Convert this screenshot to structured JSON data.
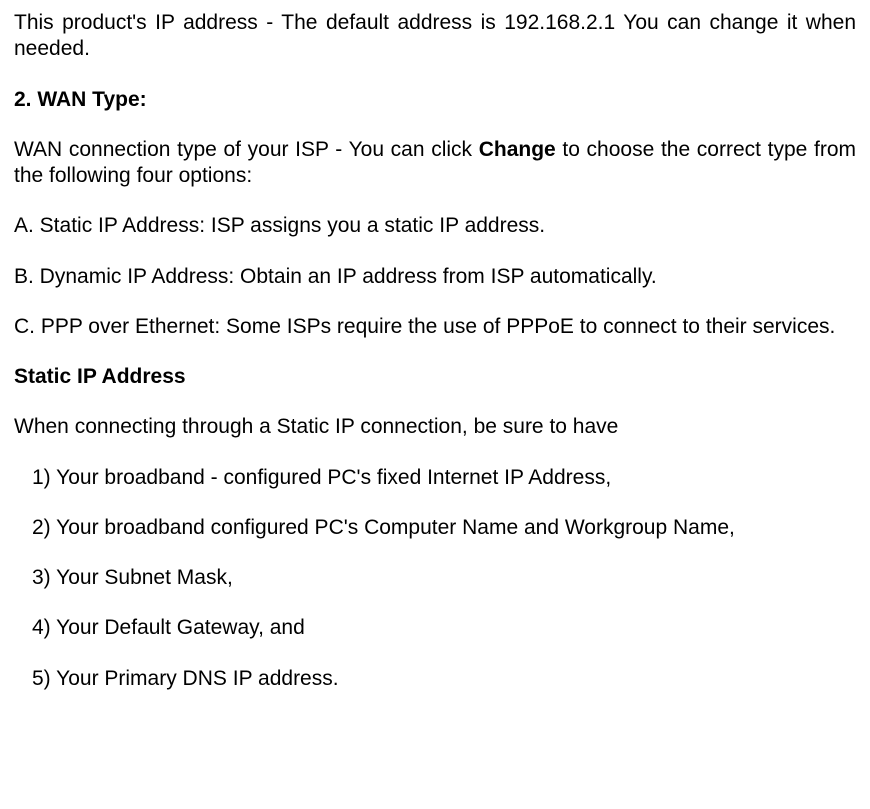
{
  "intro": {
    "p1": "This product's IP address - The default address is 192.168.2.1 You can change it when needed."
  },
  "section2": {
    "heading": "2. WAN Type:",
    "lead_pre": "WAN connection type of your ISP - You can click ",
    "lead_bold": "Change",
    "lead_post": " to choose the correct type from the following four options:",
    "optA": "A. Static IP Address: ISP assigns you a static IP address.",
    "optB": "B. Dynamic IP Address: Obtain an IP address from ISP automatically.",
    "optC": "C. PPP over Ethernet: Some ISPs require the use of PPPoE to connect to their services."
  },
  "staticip": {
    "heading": "Static IP Address",
    "lead": "When connecting through a Static IP connection, be sure to have",
    "items": [
      "1) Your broadband - configured PC's fixed Internet IP Address,",
      "2) Your broadband configured PC's Computer Name and Workgroup Name,",
      "3) Your Subnet Mask,",
      "4) Your Default Gateway, and",
      "5) Your Primary DNS IP address."
    ]
  }
}
